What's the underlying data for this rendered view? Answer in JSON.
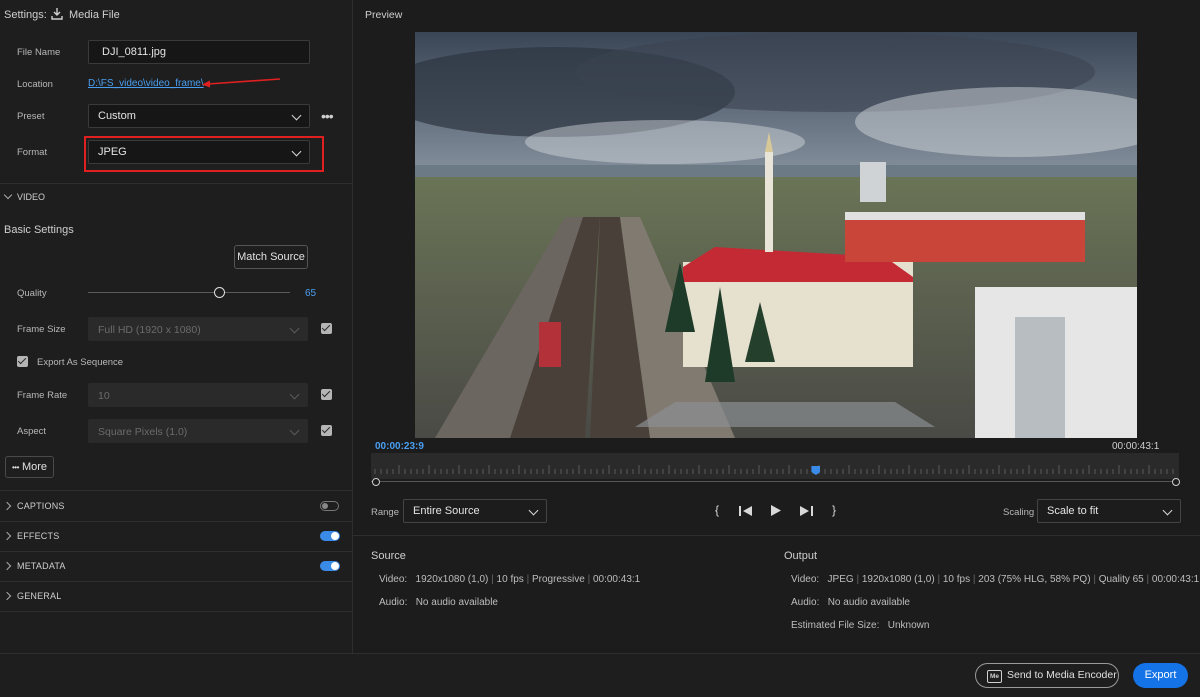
{
  "header": {
    "settings_label": "Settings:",
    "media_file_label": "Media File"
  },
  "fields": {
    "file_name_label": "File Name",
    "file_name_value": "DJI_0811.jpg",
    "location_label": "Location",
    "location_value": "D:\\FS_video\\video_frame\\",
    "preset_label": "Preset",
    "preset_value": "Custom",
    "format_label": "Format",
    "format_value": "JPEG"
  },
  "video_section": {
    "title": "VIDEO",
    "basic_settings": "Basic Settings",
    "match_source": "Match Source",
    "quality_label": "Quality",
    "quality_value": "65",
    "quality_fraction": 0.65,
    "frame_size_label": "Frame Size",
    "frame_size_value": "Full HD (1920 x 1080)",
    "export_sequence_label": "Export As Sequence",
    "frame_rate_label": "Frame Rate",
    "frame_rate_value": "10",
    "aspect_label": "Aspect",
    "aspect_value": "Square Pixels (1.0)",
    "more_label": "More"
  },
  "sections": [
    {
      "title": "CAPTIONS",
      "toggle": "off"
    },
    {
      "title": "EFFECTS",
      "toggle": "on"
    },
    {
      "title": "METADATA",
      "toggle": "on"
    },
    {
      "title": "GENERAL"
    }
  ],
  "preview": {
    "title": "Preview",
    "current_time": "00:00:23:9",
    "duration": "00:00:43:1",
    "playhead_fraction": 0.55,
    "range_label": "Range",
    "range_value": "Entire Source",
    "scaling_label": "Scaling",
    "scaling_value": "Scale to fit"
  },
  "source": {
    "title": "Source",
    "video_label": "Video:",
    "video_items": [
      "1920x1080 (1,0)",
      "10 fps",
      "Progressive",
      "00:00:43:1"
    ],
    "audio_label": "Audio:",
    "audio_value": "No audio available"
  },
  "output": {
    "title": "Output",
    "video_label": "Video:",
    "video_items": [
      "JPEG",
      "1920x1080 (1,0)",
      "10 fps",
      "203 (75% HLG, 58% PQ)",
      "Quality 65",
      "00:00:43:1"
    ],
    "audio_label": "Audio:",
    "audio_value": "No audio available",
    "size_label": "Estimated File Size:",
    "size_value": "Unknown"
  },
  "footer": {
    "send_label": "Send to Media Encoder",
    "me_badge": "Me",
    "export_label": "Export"
  },
  "colors": {
    "accent": "#3a8be8",
    "highlight": "#e02020",
    "link": "#4a9ef0",
    "export": "#1473e6"
  }
}
